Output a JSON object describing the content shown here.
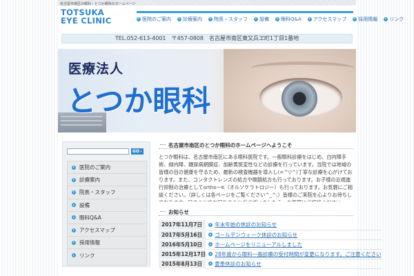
{
  "header": {
    "tagline": "名古屋市南区の眼科・とつか眼科のホームページ",
    "logo_line1": "TOTSUKA",
    "logo_line2": "EYE CLINIC"
  },
  "nav": {
    "items": [
      {
        "label": "医院のご案内"
      },
      {
        "label": "診療案内"
      },
      {
        "label": "院長・スタッフ"
      },
      {
        "label": "設備"
      },
      {
        "label": "眼科Q&A"
      },
      {
        "label": "アクセスマップ"
      },
      {
        "label": "採用情報"
      },
      {
        "label": "リンク"
      }
    ]
  },
  "contact": {
    "text": "TEL.052-613-4001　〒457-0808　名古屋市南区東又兵ヱ町1丁目1番地"
  },
  "hero": {
    "subtitle": "医療法人",
    "title": "とつか眼科"
  },
  "search": {
    "placeholder": "",
    "go_label": "GO"
  },
  "sidebar": {
    "items": [
      {
        "label": "医院のご案内"
      },
      {
        "label": "診療案内"
      },
      {
        "label": "院長・スタッフ"
      },
      {
        "label": "設備"
      },
      {
        "label": "眼科Q&A"
      },
      {
        "label": "アクセスマップ"
      },
      {
        "label": "採用情報"
      },
      {
        "label": "リンク"
      }
    ]
  },
  "main": {
    "welcome_title": "名古屋市南区のとつか眼科のホームページへようこそ",
    "intro_text": "とつか眼科は、名古屋市南区にある眼科医院です。一般眼科診療をはじめ、白内障手術、緑内障、糖尿病網膜症、加齢黄斑変性などの診療を行っています。当院では地域の皆様の目の健康を守るため、最新の検査機器を導入し(=^▽^)丁寧な診療を心がけております。また、コンタクトレンズの処方や眼鏡処方も行っております。お子様の近視進行抑制の治療としてorthoーK（オルソケラトロジー）も行っております。お気軽にご相談ください。（詳しくは各ページをご覧ください^_^;）皆様のご来院を心よりお待ちしております。目のことでお困りのことがございましたら、お気軽にご相談ください。",
    "news_title": "お知らせ",
    "news": [
      {
        "date": "2017年11月7日",
        "text": "年末年始の休診のお知らせ"
      },
      {
        "date": "2017年5月16日",
        "text": "ゴールデンウィーク休診のお知らせ"
      },
      {
        "date": "2016年5月10日",
        "text": "ホームページをリニューアルしました"
      },
      {
        "date": "2015年12月17日",
        "text": "28年度から眼科一般診療の受付時間が変更になります。ご注意ください"
      },
      {
        "date": "2015年8月13日",
        "text": "夏季休診のお知らせ"
      }
    ]
  },
  "colors": {
    "accent": "#3a9bd5",
    "logo": "#2a86c8",
    "hero_title": "#1f6fd0",
    "hero_subtitle": "#1d2a5e",
    "link": "#2a6fb0"
  },
  "icons": {
    "nav_bullet": "arrow-circle-icon",
    "search_go": "go-arrow-icon"
  }
}
